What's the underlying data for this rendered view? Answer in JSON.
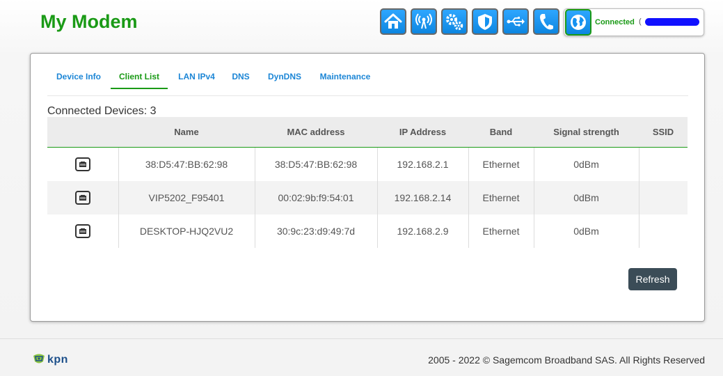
{
  "app": {
    "title": "My Modem"
  },
  "nav_icons": [
    {
      "name": "home-icon"
    },
    {
      "name": "wifi-icon"
    },
    {
      "name": "gears-icon"
    },
    {
      "name": "shield-icon"
    },
    {
      "name": "usb-icon"
    },
    {
      "name": "phone-icon"
    }
  ],
  "status": {
    "icon": "globe-icon",
    "label": "Connected",
    "paren": "(",
    "color": "#1a9a16"
  },
  "tabs": [
    {
      "label": "Device Info",
      "active": false
    },
    {
      "label": "Client List",
      "active": true
    },
    {
      "label": "LAN IPv4",
      "active": false
    },
    {
      "label": "DNS",
      "active": false
    },
    {
      "label": "DynDNS",
      "active": false
    },
    {
      "label": "Maintenance",
      "active": false
    }
  ],
  "devices": {
    "heading": "Connected Devices: 3",
    "columns": [
      "",
      "Name",
      "MAC address",
      "IP Address",
      "Band",
      "Signal strength",
      "SSID"
    ],
    "rows": [
      {
        "icon": "ethernet-icon",
        "name": "38:D5:47:BB:62:98",
        "mac": "38:D5:47:BB:62:98",
        "ip": "192.168.2.1",
        "band": "Ethernet",
        "signal": "0dBm",
        "ssid": ""
      },
      {
        "icon": "ethernet-icon",
        "name": "VIP5202_F95401",
        "mac": "00:02:9b:f9:54:01",
        "ip": "192.168.2.14",
        "band": "Ethernet",
        "signal": "0dBm",
        "ssid": ""
      },
      {
        "icon": "ethernet-icon",
        "name": "DESKTOP-HJQ2VU2",
        "mac": "30:9c:23:d9:49:7d",
        "ip": "192.168.2.9",
        "band": "Ethernet",
        "signal": "0dBm",
        "ssid": ""
      }
    ],
    "refresh_label": "Refresh"
  },
  "footer": {
    "brand": "kpn",
    "copyright": "2005 - 2022 © Sagemcom Broadband SAS. All Rights Reserved"
  },
  "colors": {
    "accent_green": "#1a9a16",
    "link_blue": "#1c86d6",
    "button_dark": "#3b4c57",
    "icon_blue": "#1592f0"
  }
}
